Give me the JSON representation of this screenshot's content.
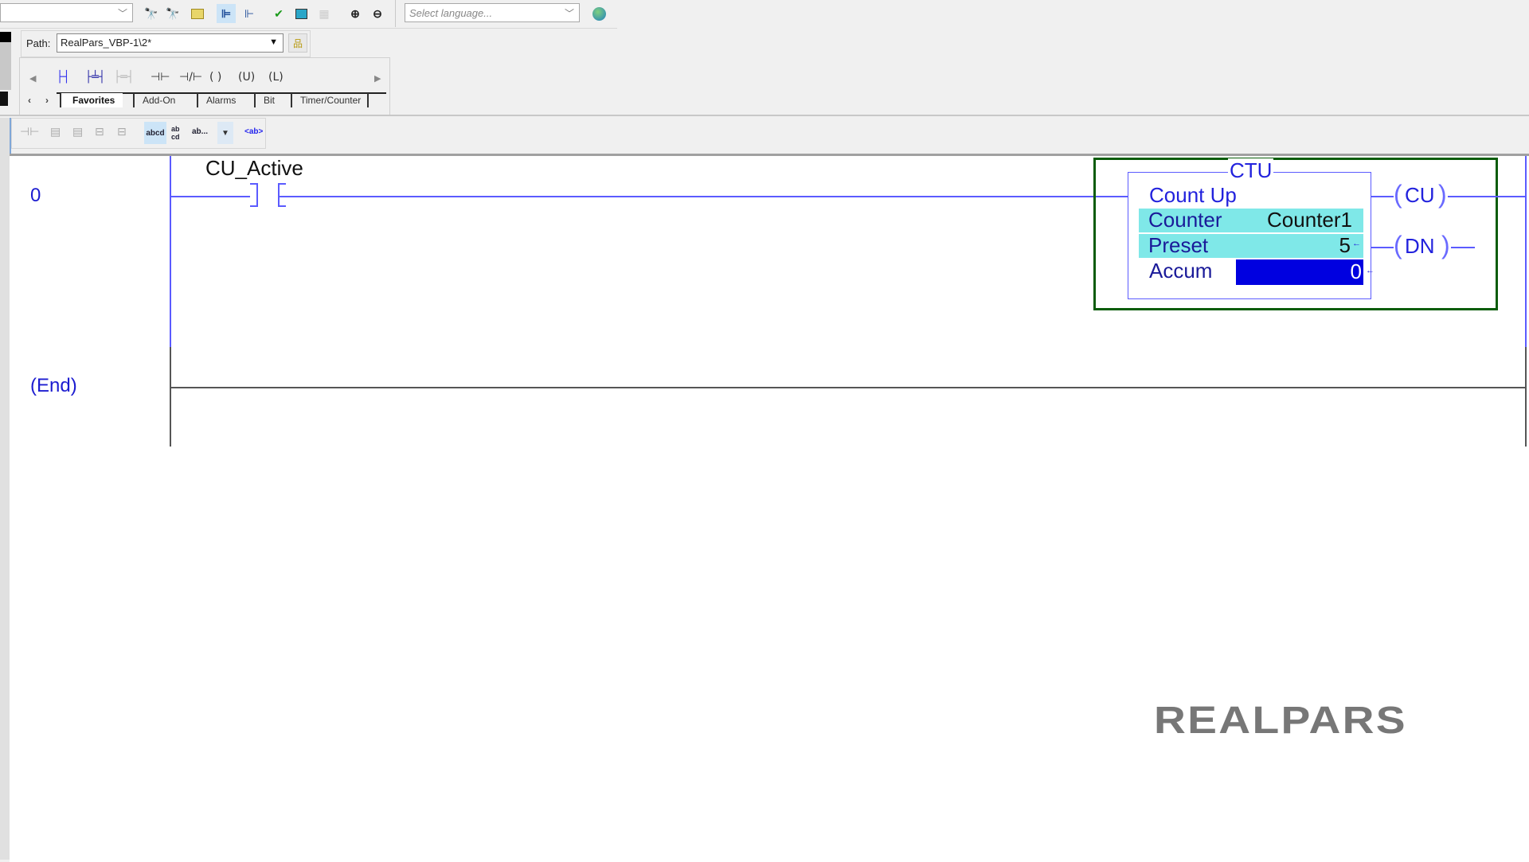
{
  "toolbar": {
    "routine_combo_value": "",
    "language_placeholder": "Select language...",
    "icons": [
      "find-previous-icon",
      "find-next-icon",
      "browse-logic-icon",
      "tree-view-icon",
      "tree-branch-icon",
      "verify-routine-icon",
      "verify-controller-icon",
      "grid-icon",
      "zoom-in-icon",
      "zoom-out-icon",
      "language-globe-icon"
    ]
  },
  "path": {
    "label": "Path:",
    "value": "RealPars_VBP-1\\2*"
  },
  "palette": {
    "items": [
      "rung",
      "branch",
      "branch-level",
      "XIC",
      "XIO",
      "OTE",
      "OTU",
      "OTL"
    ],
    "glyphs": {
      "xic": "⊣⊢",
      "xio": "⊣/⊢",
      "ote": "( )",
      "otu": "(U)",
      "otl": "(L)"
    },
    "tabs": [
      {
        "label": "Favorites",
        "active": true
      },
      {
        "label": "Add-On",
        "active": false
      },
      {
        "label": "Alarms",
        "active": false
      },
      {
        "label": "Bit",
        "active": false
      },
      {
        "label": "Timer/Counter",
        "active": false
      }
    ]
  },
  "display_toolbar": {
    "tag_mode_labels": [
      "abcd",
      "ab cd",
      "ab..."
    ],
    "desc_label": "<ab>"
  },
  "ladder": {
    "rungs": [
      {
        "number": "0",
        "contact": {
          "type": "XIC",
          "tag": "CU_Active"
        },
        "instruction": {
          "mnemonic": "CTU",
          "title": "Count Up",
          "params": [
            {
              "name": "Counter",
              "value": "Counter1"
            },
            {
              "name": "Preset",
              "value": "5"
            },
            {
              "name": "Accum",
              "value": "0"
            }
          ],
          "outputs": [
            "CU",
            "DN"
          ]
        }
      }
    ],
    "end_label": "(End)"
  },
  "watermark": "REALPARS",
  "colors": {
    "wire": "#5b5bff",
    "rung_number": "#1c1cd0",
    "instruction_box": "#0a5c0a",
    "param_highlight": "#7fe8e8",
    "accum_highlight": "#0000e0"
  }
}
